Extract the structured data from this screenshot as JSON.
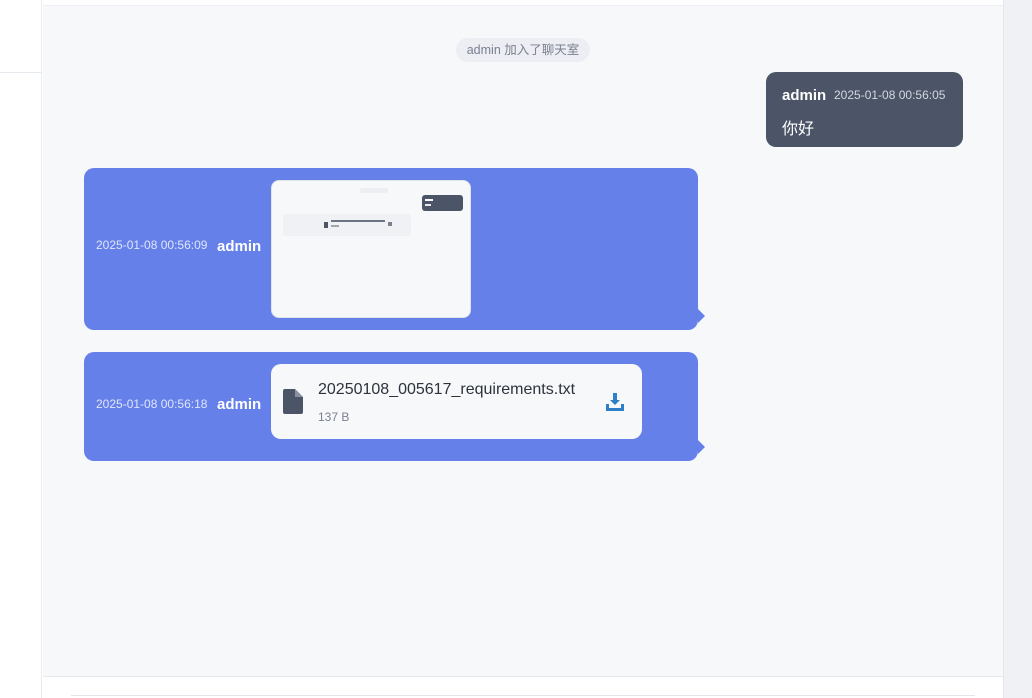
{
  "system_message": "admin 加入了聊天室",
  "messages": [
    {
      "kind": "text",
      "own": true,
      "sender": "admin",
      "time": "2025-01-08 00:56:05",
      "text": "你好"
    },
    {
      "kind": "image",
      "own": false,
      "sender": "admin",
      "time": "2025-01-08 00:56:09",
      "image_icon": "image-thumbnail"
    },
    {
      "kind": "file",
      "own": false,
      "sender": "admin",
      "time": "2025-01-08 00:56:18",
      "file_name": "20250108_005617_requirements.txt",
      "file_size": "137 B",
      "file_icon": "file-icon",
      "download_icon": "download-icon"
    }
  ],
  "colors": {
    "own_bubble": "#4b5567",
    "incoming_bubble": "#6680ea",
    "chat_background": "#f7f8fa",
    "download_accent": "#2f7fc8"
  }
}
